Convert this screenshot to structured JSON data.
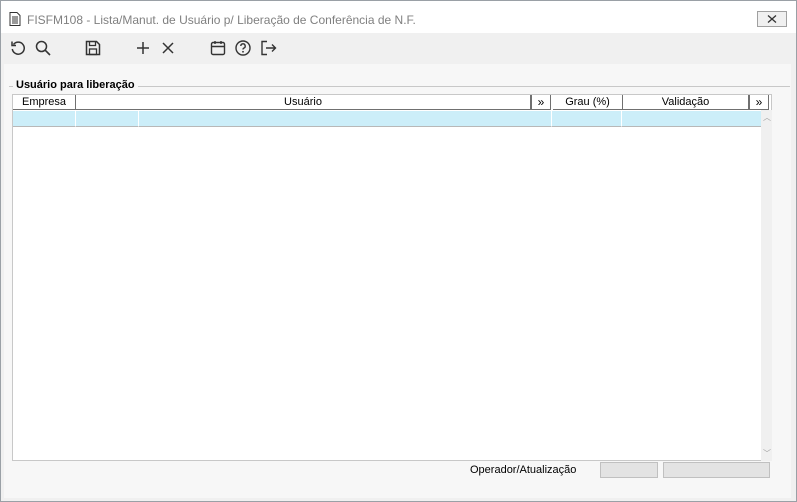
{
  "window": {
    "title": "FISFM108 - Lista/Manut. de Usuário p/ Liberação de Conferência de N.F.",
    "icons": {
      "app": "document-icon",
      "close": "close-icon"
    }
  },
  "toolbar": {
    "buttons": [
      {
        "name": "refresh",
        "icon": "refresh-icon"
      },
      {
        "name": "search",
        "icon": "search-icon"
      },
      {
        "name": "save",
        "icon": "save-icon"
      },
      {
        "name": "add",
        "icon": "plus-icon"
      },
      {
        "name": "delete",
        "icon": "close-icon"
      },
      {
        "name": "calendar",
        "icon": "calendar-icon"
      },
      {
        "name": "help",
        "icon": "help-icon"
      },
      {
        "name": "exit",
        "icon": "exit-icon"
      }
    ]
  },
  "group": {
    "title": "Usuário para liberação"
  },
  "grid": {
    "columns": [
      "Empresa",
      "Usuário",
      "Grau (%)",
      "Validação"
    ],
    "more_symbol": "»",
    "rows": [
      {
        "empresa": "",
        "codigo": "",
        "usuario": "",
        "grau": "",
        "validacao": ""
      }
    ],
    "selected_row_color": "#cceef9"
  },
  "footer": {
    "label": "Operador/Atualização",
    "operador": "",
    "atualizacao": ""
  },
  "colors": {
    "title_text": "#808080",
    "panel": "#f7f7f7",
    "toolbar": "#f0f0f0"
  }
}
